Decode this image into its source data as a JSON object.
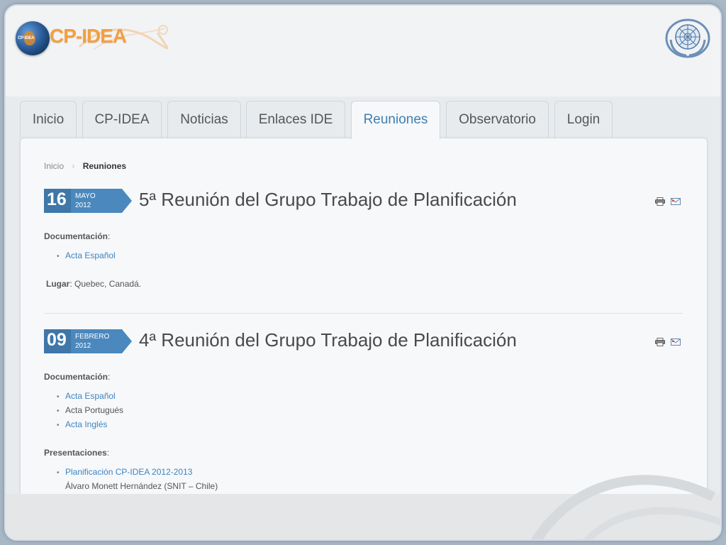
{
  "site": {
    "brand": "CP-IDEA",
    "globe_text": "CP-IDEA"
  },
  "nav": {
    "tabs": [
      {
        "label": "Inicio"
      },
      {
        "label": "CP-IDEA"
      },
      {
        "label": "Noticias"
      },
      {
        "label": "Enlaces IDE"
      },
      {
        "label": "Reuniones",
        "active": true
      },
      {
        "label": "Observatorio"
      },
      {
        "label": "Login"
      }
    ]
  },
  "breadcrumb": {
    "home": "Inicio",
    "current": "Reuniones"
  },
  "meetings": [
    {
      "day": "16",
      "month": "MAYO",
      "year": "2012",
      "title": "5ª Reunión del Grupo Trabajo de Planificación",
      "doc_label": "Documentación",
      "docs": [
        {
          "label": "Acta Español",
          "link": true
        }
      ],
      "place_label": "Lugar",
      "place_value": ": Quebec, Canadá."
    },
    {
      "day": "09",
      "month": "FEBRERO",
      "year": "2012",
      "title": "4ª Reunión del Grupo Trabajo de Planificación",
      "doc_label": "Documentación",
      "docs": [
        {
          "label": "Acta Español",
          "link": true
        },
        {
          "label": "Acta Portugués",
          "link": false
        },
        {
          "label": "Acta Inglés",
          "link": true
        }
      ],
      "pres_label": "Presentaciones",
      "presentations": [
        {
          "label": "Planificación CP-IDEA 2012-2013",
          "author": "Álvaro Monett Hernández (SNIT – Chile)"
        }
      ]
    }
  ],
  "colors": {
    "accent": "#3f7fb1",
    "link": "#3d84c0",
    "badge": "#4b88bd",
    "brand": "#f3a040"
  },
  "icons": [
    "print-icon",
    "email-icon"
  ]
}
